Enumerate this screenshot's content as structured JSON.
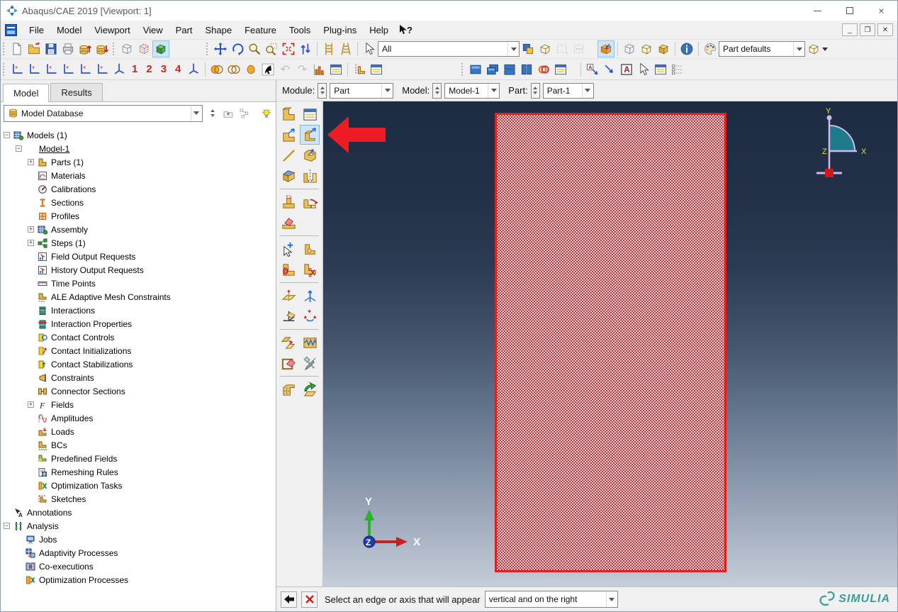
{
  "window": {
    "title": "Abaqus/CAE 2019 [Viewport: 1]",
    "controls": {
      "minimize": "",
      "maximize": "",
      "close": "×"
    },
    "mdi_controls": {
      "minimize": "_",
      "restore": "❐",
      "close": "✕"
    }
  },
  "menubar": {
    "items": [
      "File",
      "Model",
      "Viewport",
      "View",
      "Part",
      "Shape",
      "Feature",
      "Tools",
      "Plug-ins",
      "Help"
    ],
    "context_help": "?"
  },
  "toolbars": {
    "select_filter_value": "All",
    "color_code_value": "Part defaults",
    "view_numbers": [
      "1",
      "2",
      "3",
      "4"
    ],
    "undo_glyph": "↶",
    "redo_glyph": "↷"
  },
  "context_bar": {
    "module_label": "Module:",
    "module_value": "Part",
    "model_label": "Model:",
    "model_value": "Model-1",
    "part_label": "Part:",
    "part_value": "Part-1"
  },
  "left_panel": {
    "tabs": [
      {
        "label": "Model"
      },
      {
        "label": "Results"
      }
    ],
    "database_combo_value": "Model Database",
    "tree": {
      "items": [
        {
          "label": "Models (1)",
          "cls": "lvl0 exp-minus",
          "icon": "t-grid"
        },
        {
          "label": "Model-1",
          "cls": "lvl1 exp-minus underline",
          "icon": "t-none"
        },
        {
          "label": "Parts (1)",
          "cls": "lvl2 exp-plus",
          "icon": "t-part"
        },
        {
          "label": "Materials",
          "cls": "lvl2 exp-none",
          "icon": "t-mat"
        },
        {
          "label": "Calibrations",
          "cls": "lvl2 exp-none",
          "icon": "t-cal"
        },
        {
          "label": "Sections",
          "cls": "lvl2 exp-none",
          "icon": "t-sec"
        },
        {
          "label": "Profiles",
          "cls": "lvl2 exp-none",
          "icon": "t-prof"
        },
        {
          "label": "Assembly",
          "cls": "lvl2 exp-plus",
          "icon": "t-grid"
        },
        {
          "label": "Steps (1)",
          "cls": "lvl2 exp-plus",
          "icon": "t-step"
        },
        {
          "label": "Field Output Requests",
          "cls": "lvl2 exp-none",
          "icon": "t-out"
        },
        {
          "label": "History Output Requests",
          "cls": "lvl2 exp-none",
          "icon": "t-out"
        },
        {
          "label": "Time Points",
          "cls": "lvl2 exp-none",
          "icon": "t-time"
        },
        {
          "label": "ALE Adaptive Mesh Constraints",
          "cls": "lvl2 exp-none",
          "icon": "t-ale"
        },
        {
          "label": "Interactions",
          "cls": "lvl2 exp-none",
          "icon": "t-int"
        },
        {
          "label": "Interaction Properties",
          "cls": "lvl2 exp-none",
          "icon": "t-intp"
        },
        {
          "label": "Contact Controls",
          "cls": "lvl2 exp-none",
          "icon": "t-cc"
        },
        {
          "label": "Contact Initializations",
          "cls": "lvl2 exp-none",
          "icon": "t-ci"
        },
        {
          "label": "Contact Stabilizations",
          "cls": "lvl2 exp-none",
          "icon": "t-cs"
        },
        {
          "label": "Constraints",
          "cls": "lvl2 exp-none",
          "icon": "t-con"
        },
        {
          "label": "Connector Sections",
          "cls": "lvl2 exp-none",
          "icon": "t-conn"
        },
        {
          "label": "Fields",
          "cls": "lvl2 exp-plus",
          "icon": "t-field"
        },
        {
          "label": "Amplitudes",
          "cls": "lvl2 exp-none",
          "icon": "t-amp"
        },
        {
          "label": "Loads",
          "cls": "lvl2 exp-none",
          "icon": "t-load"
        },
        {
          "label": "BCs",
          "cls": "lvl2 exp-none",
          "icon": "t-bc"
        },
        {
          "label": "Predefined Fields",
          "cls": "lvl2 exp-none",
          "icon": "t-pre"
        },
        {
          "label": "Remeshing Rules",
          "cls": "lvl2 exp-none",
          "icon": "t-rem"
        },
        {
          "label": "Optimization Tasks",
          "cls": "lvl2 exp-none",
          "icon": "t-opt"
        },
        {
          "label": "Sketches",
          "cls": "lvl2 exp-none",
          "icon": "t-sk"
        },
        {
          "label": "Annotations",
          "cls": "lvl0 exp-none",
          "icon": "t-ann"
        },
        {
          "label": "Analysis",
          "cls": "lvl0 exp-minus",
          "icon": "t-ana"
        },
        {
          "label": "Jobs",
          "cls": "lvl1 exp-none",
          "icon": "t-job"
        },
        {
          "label": "Adaptivity Processes",
          "cls": "lvl1 exp-none",
          "icon": "t-adp"
        },
        {
          "label": "Co-executions",
          "cls": "lvl1 exp-none",
          "icon": "t-co"
        },
        {
          "label": "Optimization Processes",
          "cls": "lvl1 exp-none",
          "icon": "t-opr"
        }
      ]
    }
  },
  "viewport": {
    "triad": {
      "x": "X",
      "y": "Y",
      "z": "Z"
    },
    "compass": {
      "x": "X",
      "y": "Y",
      "z": "Z"
    }
  },
  "prompt_bar": {
    "message": "Select an edge or axis that will appear",
    "combo_value": "vertical and on the right"
  },
  "branding": {
    "brand": "SIMULIA"
  },
  "colors": {
    "highlight_fill": "#c5333a",
    "highlight_border": "#e02020",
    "annotation_arrow": "#ec1c24",
    "viewport_top": "#1d2c42",
    "viewport_bottom": "#c6cdd8",
    "logo_teal": "#3a9e98",
    "tool_selected_bg": "#cde6f7"
  }
}
